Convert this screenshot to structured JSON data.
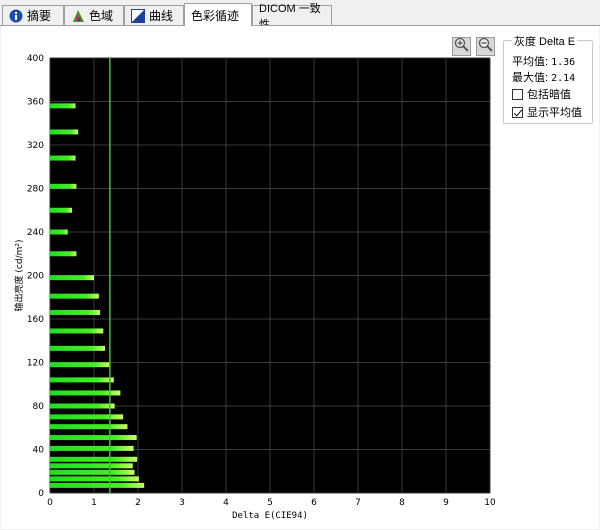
{
  "tabs": [
    {
      "label": "摘要",
      "icon": "info-icon",
      "active": false
    },
    {
      "label": "色域",
      "icon": "gamut-icon",
      "active": false
    },
    {
      "label": "曲线",
      "icon": "curve-icon",
      "active": false
    },
    {
      "label": "色彩循迹",
      "icon": "",
      "active": true
    },
    {
      "label": "DICOM 一致性",
      "icon": "",
      "active": false
    }
  ],
  "toolbar": {
    "zoom_in_icon": "zoom-in-icon",
    "zoom_out_icon": "zoom-out-icon"
  },
  "panel": {
    "title": "灰度 Delta E",
    "avg_label": "平均值:",
    "avg_value": "1.36",
    "max_label": "最大值:",
    "max_value": "2.14",
    "include_dark_label": "包括暗值",
    "include_dark_checked": false,
    "show_avg_label": "显示平均值",
    "show_avg_checked": true
  },
  "colors": {
    "plot_bg": "#000000",
    "bar_green": "#33ee22",
    "mean_line": "#3cc43c",
    "grid": "#3a3a3a"
  },
  "chart_data": {
    "type": "bar",
    "orientation": "horizontal",
    "xlabel": "Delta E(CIE94)",
    "ylabel": "输出亮度 (cd/m²)",
    "xlim": [
      0,
      10
    ],
    "ylim": [
      0,
      400
    ],
    "xticks": [
      "0",
      "1",
      "2",
      "3",
      "4",
      "5",
      "6",
      "7",
      "8",
      "9",
      "10"
    ],
    "yticks": [
      "0",
      "40",
      "80",
      "120",
      "160",
      "200",
      "240",
      "280",
      "320",
      "360",
      "400"
    ],
    "mean_line": 1.36,
    "bars": [
      {
        "y": 7,
        "value": 2.14
      },
      {
        "y": 13,
        "value": 2.02
      },
      {
        "y": 19,
        "value": 1.92
      },
      {
        "y": 25,
        "value": 1.88
      },
      {
        "y": 31,
        "value": 1.98
      },
      {
        "y": 41,
        "value": 1.9
      },
      {
        "y": 51,
        "value": 1.97
      },
      {
        "y": 61,
        "value": 1.76
      },
      {
        "y": 70,
        "value": 1.66
      },
      {
        "y": 80,
        "value": 1.47
      },
      {
        "y": 92,
        "value": 1.6
      },
      {
        "y": 104,
        "value": 1.45
      },
      {
        "y": 118,
        "value": 1.36
      },
      {
        "y": 133,
        "value": 1.25
      },
      {
        "y": 149,
        "value": 1.21
      },
      {
        "y": 166,
        "value": 1.14
      },
      {
        "y": 181,
        "value": 1.11
      },
      {
        "y": 198,
        "value": 1.0
      },
      {
        "y": 220,
        "value": 0.6
      },
      {
        "y": 240,
        "value": 0.4
      },
      {
        "y": 260,
        "value": 0.5
      },
      {
        "y": 282,
        "value": 0.6
      },
      {
        "y": 308,
        "value": 0.58
      },
      {
        "y": 332,
        "value": 0.64
      },
      {
        "y": 356,
        "value": 0.58
      }
    ]
  }
}
